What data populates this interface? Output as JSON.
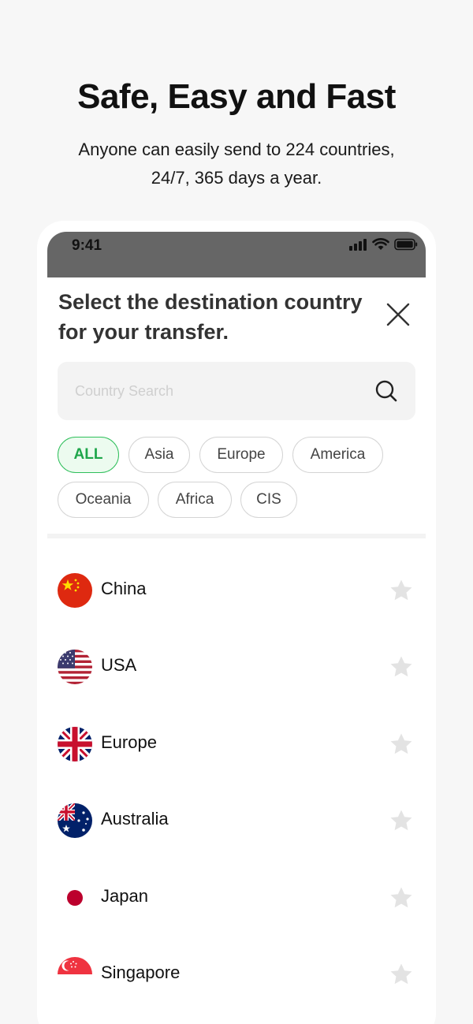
{
  "hero": {
    "title": "Safe, Easy and Fast",
    "subtitle_line1": "Anyone can easily send to 224 countries,",
    "subtitle_line2": "24/7, 365 days a year."
  },
  "status_bar": {
    "time": "9:41"
  },
  "sheet": {
    "title_line1": "Select the destination country",
    "title_line2": "for your transfer.",
    "search_placeholder": "Country Search"
  },
  "filters": [
    {
      "label": "ALL",
      "selected": true
    },
    {
      "label": "Asia",
      "selected": false
    },
    {
      "label": "Europe",
      "selected": false
    },
    {
      "label": "America",
      "selected": false
    },
    {
      "label": "Oceania",
      "selected": false
    },
    {
      "label": "Africa",
      "selected": false
    },
    {
      "label": "CIS",
      "selected": false
    }
  ],
  "countries": [
    {
      "name": "China",
      "flag": "china-flag-icon",
      "favorite": false
    },
    {
      "name": "USA",
      "flag": "usa-flag-icon",
      "favorite": false
    },
    {
      "name": "Europe",
      "flag": "uk-flag-icon",
      "favorite": false
    },
    {
      "name": "Australia",
      "flag": "australia-flag-icon",
      "favorite": false
    },
    {
      "name": "Japan",
      "flag": "japan-flag-icon",
      "favorite": false
    },
    {
      "name": "Singapore",
      "flag": "singapore-flag-icon",
      "favorite": false
    }
  ],
  "colors": {
    "accent": "#2fbf5b",
    "accent_bg": "#ecfbef",
    "status_bar": "#666666",
    "star_inactive": "#e3e3e3"
  }
}
